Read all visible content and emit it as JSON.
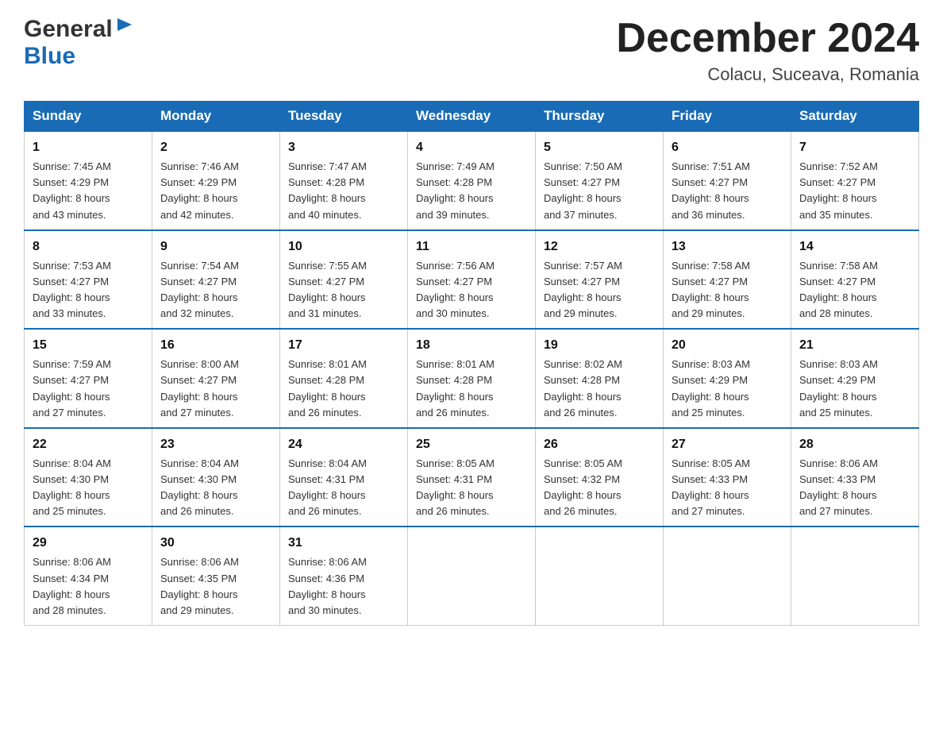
{
  "header": {
    "logo_general": "General",
    "logo_blue": "Blue",
    "month_title": "December 2024",
    "location": "Colacu, Suceava, Romania"
  },
  "days_of_week": [
    "Sunday",
    "Monday",
    "Tuesday",
    "Wednesday",
    "Thursday",
    "Friday",
    "Saturday"
  ],
  "weeks": [
    [
      {
        "day": "1",
        "sunrise": "7:45 AM",
        "sunset": "4:29 PM",
        "daylight": "8 hours and 43 minutes."
      },
      {
        "day": "2",
        "sunrise": "7:46 AM",
        "sunset": "4:29 PM",
        "daylight": "8 hours and 42 minutes."
      },
      {
        "day": "3",
        "sunrise": "7:47 AM",
        "sunset": "4:28 PM",
        "daylight": "8 hours and 40 minutes."
      },
      {
        "day": "4",
        "sunrise": "7:49 AM",
        "sunset": "4:28 PM",
        "daylight": "8 hours and 39 minutes."
      },
      {
        "day": "5",
        "sunrise": "7:50 AM",
        "sunset": "4:27 PM",
        "daylight": "8 hours and 37 minutes."
      },
      {
        "day": "6",
        "sunrise": "7:51 AM",
        "sunset": "4:27 PM",
        "daylight": "8 hours and 36 minutes."
      },
      {
        "day": "7",
        "sunrise": "7:52 AM",
        "sunset": "4:27 PM",
        "daylight": "8 hours and 35 minutes."
      }
    ],
    [
      {
        "day": "8",
        "sunrise": "7:53 AM",
        "sunset": "4:27 PM",
        "daylight": "8 hours and 33 minutes."
      },
      {
        "day": "9",
        "sunrise": "7:54 AM",
        "sunset": "4:27 PM",
        "daylight": "8 hours and 32 minutes."
      },
      {
        "day": "10",
        "sunrise": "7:55 AM",
        "sunset": "4:27 PM",
        "daylight": "8 hours and 31 minutes."
      },
      {
        "day": "11",
        "sunrise": "7:56 AM",
        "sunset": "4:27 PM",
        "daylight": "8 hours and 30 minutes."
      },
      {
        "day": "12",
        "sunrise": "7:57 AM",
        "sunset": "4:27 PM",
        "daylight": "8 hours and 29 minutes."
      },
      {
        "day": "13",
        "sunrise": "7:58 AM",
        "sunset": "4:27 PM",
        "daylight": "8 hours and 29 minutes."
      },
      {
        "day": "14",
        "sunrise": "7:58 AM",
        "sunset": "4:27 PM",
        "daylight": "8 hours and 28 minutes."
      }
    ],
    [
      {
        "day": "15",
        "sunrise": "7:59 AM",
        "sunset": "4:27 PM",
        "daylight": "8 hours and 27 minutes."
      },
      {
        "day": "16",
        "sunrise": "8:00 AM",
        "sunset": "4:27 PM",
        "daylight": "8 hours and 27 minutes."
      },
      {
        "day": "17",
        "sunrise": "8:01 AM",
        "sunset": "4:28 PM",
        "daylight": "8 hours and 26 minutes."
      },
      {
        "day": "18",
        "sunrise": "8:01 AM",
        "sunset": "4:28 PM",
        "daylight": "8 hours and 26 minutes."
      },
      {
        "day": "19",
        "sunrise": "8:02 AM",
        "sunset": "4:28 PM",
        "daylight": "8 hours and 26 minutes."
      },
      {
        "day": "20",
        "sunrise": "8:03 AM",
        "sunset": "4:29 PM",
        "daylight": "8 hours and 25 minutes."
      },
      {
        "day": "21",
        "sunrise": "8:03 AM",
        "sunset": "4:29 PM",
        "daylight": "8 hours and 25 minutes."
      }
    ],
    [
      {
        "day": "22",
        "sunrise": "8:04 AM",
        "sunset": "4:30 PM",
        "daylight": "8 hours and 25 minutes."
      },
      {
        "day": "23",
        "sunrise": "8:04 AM",
        "sunset": "4:30 PM",
        "daylight": "8 hours and 26 minutes."
      },
      {
        "day": "24",
        "sunrise": "8:04 AM",
        "sunset": "4:31 PM",
        "daylight": "8 hours and 26 minutes."
      },
      {
        "day": "25",
        "sunrise": "8:05 AM",
        "sunset": "4:31 PM",
        "daylight": "8 hours and 26 minutes."
      },
      {
        "day": "26",
        "sunrise": "8:05 AM",
        "sunset": "4:32 PM",
        "daylight": "8 hours and 26 minutes."
      },
      {
        "day": "27",
        "sunrise": "8:05 AM",
        "sunset": "4:33 PM",
        "daylight": "8 hours and 27 minutes."
      },
      {
        "day": "28",
        "sunrise": "8:06 AM",
        "sunset": "4:33 PM",
        "daylight": "8 hours and 27 minutes."
      }
    ],
    [
      {
        "day": "29",
        "sunrise": "8:06 AM",
        "sunset": "4:34 PM",
        "daylight": "8 hours and 28 minutes."
      },
      {
        "day": "30",
        "sunrise": "8:06 AM",
        "sunset": "4:35 PM",
        "daylight": "8 hours and 29 minutes."
      },
      {
        "day": "31",
        "sunrise": "8:06 AM",
        "sunset": "4:36 PM",
        "daylight": "8 hours and 30 minutes."
      },
      null,
      null,
      null,
      null
    ]
  ],
  "labels": {
    "sunrise": "Sunrise:",
    "sunset": "Sunset:",
    "daylight": "Daylight:"
  }
}
